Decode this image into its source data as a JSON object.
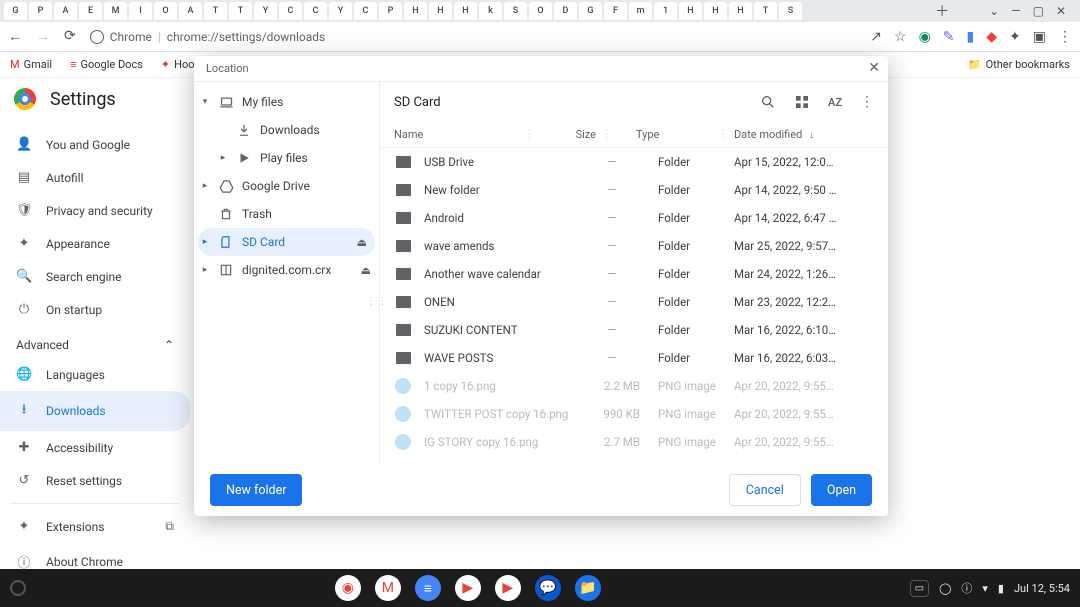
{
  "browser": {
    "tabs": [
      "G",
      "P",
      "A",
      "E",
      "M",
      "I",
      "O",
      "A",
      "T",
      "T",
      "Y",
      "C",
      "C",
      "Y",
      "C",
      "P",
      "H",
      "H",
      "H",
      "k",
      "S",
      "O",
      "D",
      "G",
      "F",
      "m",
      "1",
      "H",
      "H",
      "H",
      "T",
      "S"
    ],
    "nav_back": "←",
    "nav_forward": "→",
    "nav_reload": "⟳",
    "address_host": "Chrome",
    "address_path": "chrome://settings/downloads"
  },
  "bookmarks": {
    "items": [
      {
        "icon": "M",
        "label": "Gmail"
      },
      {
        "icon": "≡",
        "label": "Google Docs"
      },
      {
        "icon": "✦",
        "label": "Hootsuite"
      }
    ],
    "other": "Other bookmarks"
  },
  "settings": {
    "title": "Settings",
    "nav": [
      {
        "icon": "👤",
        "label": "You and Google"
      },
      {
        "icon": "▤",
        "label": "Autofill"
      },
      {
        "icon": "🛡",
        "label": "Privacy and security"
      },
      {
        "icon": "✦",
        "label": "Appearance"
      },
      {
        "icon": "🔍",
        "label": "Search engine"
      },
      {
        "icon": "⏻",
        "label": "On startup"
      }
    ],
    "advanced": "Advanced",
    "advanced_items": [
      {
        "icon": "🌐",
        "label": "Languages"
      },
      {
        "icon": "⭳",
        "label": "Downloads",
        "selected": true
      },
      {
        "icon": "✚",
        "label": "Accessibility"
      },
      {
        "icon": "↺",
        "label": "Reset settings"
      }
    ],
    "footer": [
      {
        "icon": "✦",
        "label": "Extensions",
        "ext": true
      },
      {
        "icon": "ⓘ",
        "label": "About Chrome"
      }
    ]
  },
  "modal": {
    "title": "Location",
    "breadcrumb": "SD Card",
    "tree": [
      {
        "expander": "▾",
        "icon": "laptop",
        "label": "My files",
        "level": 0
      },
      {
        "expander": "",
        "icon": "download",
        "label": "Downloads",
        "level": 1
      },
      {
        "expander": "▸",
        "icon": "play",
        "label": "Play files",
        "level": 1
      },
      {
        "expander": "▸",
        "icon": "drive",
        "label": "Google Drive",
        "level": 0
      },
      {
        "expander": "",
        "icon": "trash",
        "label": "Trash",
        "level": 0
      },
      {
        "expander": "▸",
        "icon": "sd",
        "label": "SD Card",
        "level": 0,
        "selected": true,
        "eject": true
      },
      {
        "expander": "▸",
        "icon": "archive",
        "label": "dignited.com.crx",
        "level": 0,
        "eject": true
      }
    ],
    "columns": {
      "name": "Name",
      "size": "Size",
      "type": "Type",
      "date": "Date modified"
    },
    "files": [
      {
        "kind": "folder",
        "name": "USB Drive",
        "size": "—",
        "type": "Folder",
        "date": "Apr 15, 2022, 12:0…"
      },
      {
        "kind": "folder",
        "name": "New folder",
        "size": "—",
        "type": "Folder",
        "date": "Apr 14, 2022, 9:50 …"
      },
      {
        "kind": "folder",
        "name": "Android",
        "size": "—",
        "type": "Folder",
        "date": "Apr 14, 2022, 6:47 …"
      },
      {
        "kind": "folder",
        "name": "wave amends",
        "size": "—",
        "type": "Folder",
        "date": "Mar 25, 2022, 9:57…"
      },
      {
        "kind": "folder",
        "name": "Another wave calendar",
        "size": "—",
        "type": "Folder",
        "date": "Mar 24, 2022, 1:26…"
      },
      {
        "kind": "folder",
        "name": "ONEN",
        "size": "—",
        "type": "Folder",
        "date": "Mar 23, 2022, 12:2…"
      },
      {
        "kind": "folder",
        "name": "SUZUKI CONTENT",
        "size": "—",
        "type": "Folder",
        "date": "Mar 16, 2022, 6:10…"
      },
      {
        "kind": "folder",
        "name": "WAVE POSTS",
        "size": "—",
        "type": "Folder",
        "date": "Mar 16, 2022, 6:03…"
      },
      {
        "kind": "png",
        "name": "1 copy 16.png",
        "size": "2.2 MB",
        "type": "PNG image",
        "date": "Apr 20, 2022, 9:55…",
        "dim": true
      },
      {
        "kind": "png",
        "name": "TWITTER POST copy 16.png",
        "size": "990 KB",
        "type": "PNG image",
        "date": "Apr 20, 2022, 9:55…",
        "dim": true
      },
      {
        "kind": "png",
        "name": "IG STORY copy 16.png",
        "size": "2.7 MB",
        "type": "PNG image",
        "date": "Apr 20, 2022, 9:55…",
        "dim": true
      }
    ],
    "buttons": {
      "new_folder": "New folder",
      "cancel": "Cancel",
      "open": "Open"
    }
  },
  "shelf": {
    "apps": [
      {
        "bg": "#fff",
        "glyph": "◉",
        "name": "chrome"
      },
      {
        "bg": "#fff",
        "glyph": "M",
        "name": "gmail"
      },
      {
        "bg": "#4285f4",
        "glyph": "≡",
        "name": "docs"
      },
      {
        "bg": "#fff",
        "glyph": "▶",
        "name": "youtube"
      },
      {
        "bg": "#fff",
        "glyph": "▶",
        "name": "play"
      },
      {
        "bg": "#0b57d0",
        "glyph": "💬",
        "name": "messages"
      },
      {
        "bg": "#1a73e8",
        "glyph": "📁",
        "name": "files"
      }
    ],
    "status": {
      "date": "Jul 12, 5:54"
    }
  }
}
